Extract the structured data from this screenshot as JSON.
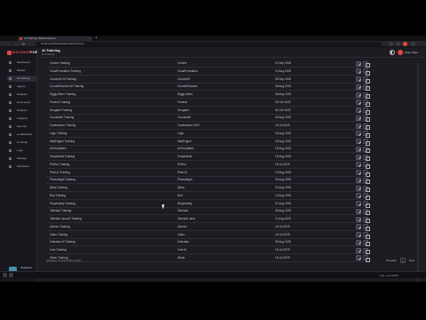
{
  "browser": {
    "tab_title": "AI Training | MachineForce",
    "tab_close": "×",
    "new_tab": "+",
    "url": "localhost:3000/dashboard/ai-training",
    "nav_back": "←",
    "nav_forward": "→",
    "nav_reload": "⟳"
  },
  "app": {
    "logo_prefix": "MACHINE",
    "logo_suffix": "FORCE",
    "brand_color": "#e0483e"
  },
  "sidebar": {
    "items": [
      {
        "label": "Dashboard",
        "icon": "grid-icon"
      },
      {
        "label": "Models",
        "icon": "cube-icon"
      },
      {
        "label": "AI Training",
        "icon": "brain-icon"
      },
      {
        "label": "Agents",
        "icon": "bot-icon"
      },
      {
        "label": "Datasets",
        "icon": "database-icon"
      },
      {
        "label": "Documents",
        "icon": "file-icon"
      },
      {
        "label": "Products",
        "icon": "box-icon"
      },
      {
        "label": "Analytics",
        "icon": "chart-icon"
      },
      {
        "label": "Security",
        "icon": "shield-icon"
      },
      {
        "label": "Localizations",
        "icon": "globe-icon"
      },
      {
        "label": "AI Studio",
        "icon": "sparkle-icon"
      },
      {
        "label": "Logs",
        "icon": "list-icon"
      },
      {
        "label": "Settings",
        "icon": "gear-icon"
      },
      {
        "label": "Workflows",
        "icon": "flow-icon"
      }
    ],
    "user": {
      "name": "Organizer",
      "org": "Workspace"
    }
  },
  "header": {
    "title": "AI Training",
    "breadcrumb": "AI Training",
    "user_name": "Kiran Patel"
  },
  "table": {
    "rows": [
      {
        "name": "Cohere Training",
        "provider": "Cohere",
        "date": "10 Sep 2025"
      },
      {
        "name": "CloudFormation Training",
        "provider": "CloudFormation",
        "date": "10 Aug 2025"
      },
      {
        "name": "ConceptX AI Training",
        "provider": "ConceptX",
        "date": "08 Sep 2025"
      },
      {
        "name": "CourseRunners AI Training",
        "provider": "CourseRunners",
        "date": "08 Aug 2025"
      },
      {
        "name": "Diggy Miner Training",
        "provider": "Diggy Miner",
        "date": "08 Aug 2025"
      },
      {
        "name": "Freebot Training",
        "provider": "Freebot",
        "date": "05 Oct 2025"
      },
      {
        "name": "Doogster Training",
        "provider": "Doogster",
        "date": "04 Oct 2025"
      },
      {
        "name": "Coursewin Training",
        "provider": "Coursewin",
        "date": "03 Aug 2025"
      },
      {
        "name": "Codewinner Training",
        "provider": "Codewinner 2047",
        "date": "18 Jul 2025"
      },
      {
        "name": "Logo Training",
        "provider": "Logo",
        "date": "16 Aug 2025"
      },
      {
        "name": "MailEngine Training",
        "provider": "MailEngine",
        "date": "15 Aug 2025"
      },
      {
        "name": "NxTemplates",
        "provider": "NxTemplates",
        "date": "15 Aug 2025"
      },
      {
        "name": "Peoplechat Training",
        "provider": "Peoplechat",
        "date": "15 Aug 2025"
      },
      {
        "name": "PinFun Training",
        "provider": "PinFun",
        "date": "18 Jul 2025"
      },
      {
        "name": "Pixel AI Training",
        "provider": "Pixel AI",
        "date": "19 Aug 2025"
      },
      {
        "name": "Pricewidget Training",
        "provider": "Pricewidget",
        "date": "26 Aug 2025"
      },
      {
        "name": "Qlinq Training",
        "provider": "Qlinq",
        "date": "20 Aug 2025"
      },
      {
        "name": "Red Training",
        "provider": "Red",
        "date": "19 Aug 2025"
      },
      {
        "name": "Shoplimetly Training",
        "provider": "Shoplimetly",
        "date": "07 Aug 2025"
      },
      {
        "name": "Talentub Training",
        "provider": "Talentub",
        "date": "06 Aug 2025"
      },
      {
        "name": "Talentub Java AI Training",
        "provider": "Talentub Java",
        "date": "11 Aug 2025"
      },
      {
        "name": "Udemo Training",
        "provider": "Udemo",
        "date": "18 Jul 2025"
      },
      {
        "name": "Vidzo Training",
        "provider": "Vidzo",
        "date": "18 Jul 2025"
      },
      {
        "name": "Velocitas AI Training",
        "provider": "Velocitas",
        "date": "09 Aug 2025"
      },
      {
        "name": "Vum Training",
        "provider": "Vum AI",
        "date": "18 Jul 2025"
      },
      {
        "name": "Webo Training",
        "provider": "Webo",
        "date": "18 Jul 2025"
      }
    ]
  },
  "footer": {
    "showing": "Showing 1 to 26 of 26 entries",
    "prev": "Previous",
    "page": "1",
    "next": "Next"
  },
  "taskbar": {
    "status": "Clip  ▸ ◂  5:32PM"
  }
}
